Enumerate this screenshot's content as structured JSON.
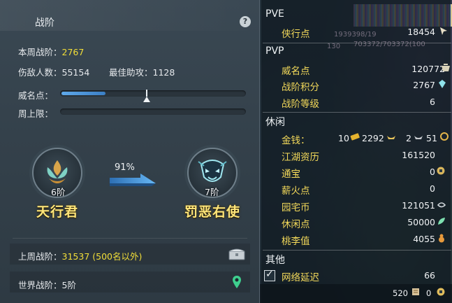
{
  "left": {
    "title": "战阶",
    "help": "?",
    "weekly_rank_label": "本周战阶：",
    "weekly_rank_value": "2767",
    "hurt_label": "伤敌人数：",
    "hurt_value": "55154",
    "assist_label": "最佳助攻：",
    "assist_value": "1128",
    "fame_label": "威名点：",
    "fame_progress": 0.24,
    "weekly_cap_label": "周上限：",
    "current_tier": "6阶",
    "current_rank_name": "天行君",
    "progress_percent": "91%",
    "next_tier": "7阶",
    "next_rank_name": "罚恶右使",
    "last_week_label": "上周战阶：",
    "last_week_value": "31537 (500名以外)",
    "world_label": "世界战阶：",
    "world_value": "5阶"
  },
  "right": {
    "pve": {
      "header": "PVE",
      "rows": [
        {
          "label": "侠行点",
          "value": "18454"
        }
      ],
      "bg_numbers": [
        "1939398/19",
        "703372/703372(100"
      ]
    },
    "pvp": {
      "header": "PVP",
      "bg_number": "130",
      "rows": [
        {
          "label": "威名点",
          "value": "120772"
        },
        {
          "label": "战阶积分",
          "value": "2767"
        },
        {
          "label": "战阶等级",
          "value": "6"
        }
      ]
    },
    "leisure": {
      "header": "休闲",
      "money_label": "金钱：",
      "money_gold": "10",
      "money_silver": "2292",
      "money_copper": "2",
      "money_extra": "51",
      "rows": [
        {
          "label": "江湖资历",
          "value": "161520"
        },
        {
          "label": "通宝",
          "value": "0"
        },
        {
          "label": "薪火点",
          "value": "0"
        },
        {
          "label": "园宅币",
          "value": "121051"
        },
        {
          "label": "休闲点",
          "value": "50000"
        },
        {
          "label": "桃李值",
          "value": "4055"
        }
      ]
    },
    "other": {
      "header": "其他",
      "latency_label": "网络延迟",
      "latency_value": "66"
    },
    "bottom": {
      "value_a": "520",
      "value_b": "0"
    }
  },
  "colors": {
    "accent_yellow": "#f3df38",
    "label_gold": "#f3d95a",
    "bar_blue": "#4f97dc"
  }
}
